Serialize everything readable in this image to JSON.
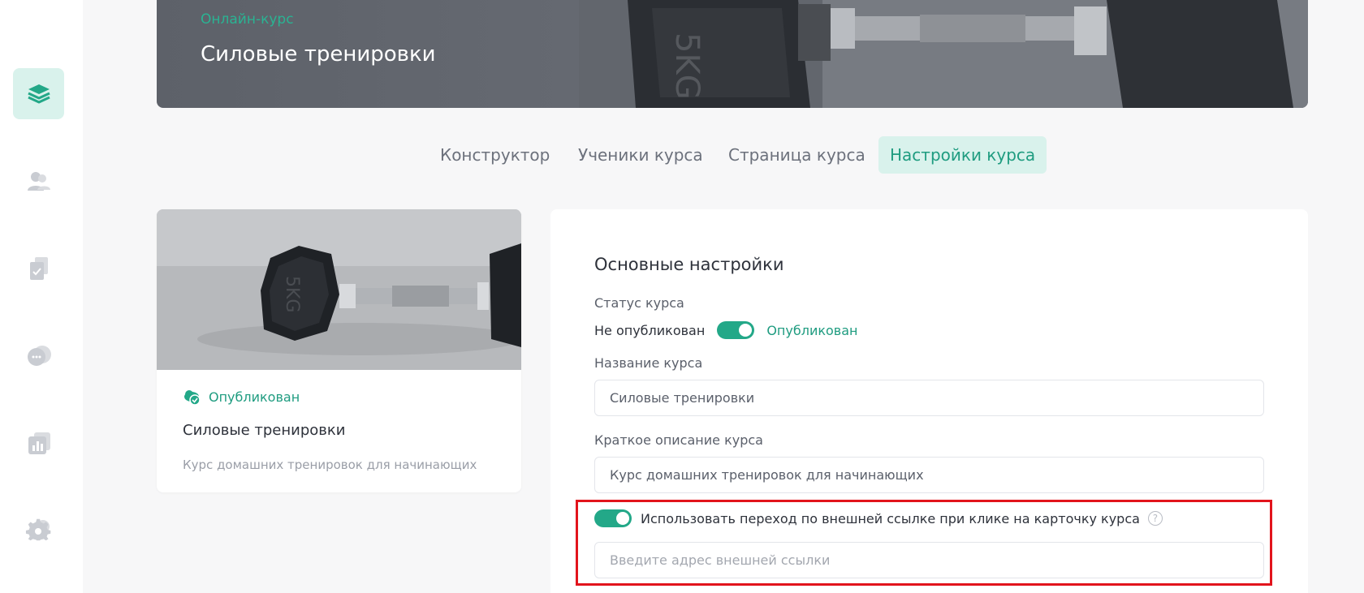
{
  "sidebar": {
    "items": [
      {
        "icon": "layers-icon",
        "active": true
      },
      {
        "icon": "users-icon",
        "active": false
      },
      {
        "icon": "document-check-icon",
        "active": false
      },
      {
        "icon": "chat-icon",
        "active": false
      },
      {
        "icon": "analytics-icon",
        "active": false
      },
      {
        "icon": "settings-icon",
        "active": false
      }
    ]
  },
  "hero": {
    "subtitle": "Онлайн-курс",
    "title": "Силовые тренировки"
  },
  "tabs": [
    {
      "label": "Конструктор",
      "active": false
    },
    {
      "label": "Ученики курса",
      "active": false
    },
    {
      "label": "Страница курса",
      "active": false
    },
    {
      "label": "Настройки курса",
      "active": true
    }
  ],
  "card": {
    "status": "Опубликован",
    "title": "Силовые тренировки",
    "description": "Курс домашних тренировок для начинающих"
  },
  "settings": {
    "section_title": "Основные настройки",
    "status_label": "Статус курса",
    "status_off": "Не опубликован",
    "status_on": "Опубликован",
    "status_toggle_on": true,
    "name_label": "Название курса",
    "name_value": "Силовые тренировки",
    "desc_label": "Краткое описание курса",
    "desc_value": "Курс домашних тренировок для начинающих",
    "external_link_toggle_on": true,
    "external_link_label": "Использовать переход по внешней ссылке при клике на карточку курса",
    "help_glyph": "?",
    "external_link_placeholder": "Введите адрес внешней ссылки"
  },
  "colors": {
    "accent": "#23a888",
    "accent_light": "#d9f2ec",
    "highlight_box": "#e2141c"
  }
}
